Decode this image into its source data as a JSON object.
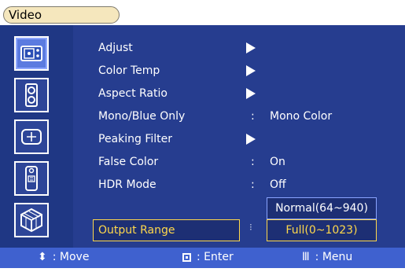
{
  "header": {
    "title": "Video"
  },
  "sidebar": {
    "items": [
      {
        "icon": "video-settings-icon"
      },
      {
        "icon": "audio-speaker-icon"
      },
      {
        "icon": "target-crosshair-icon"
      },
      {
        "icon": "remote-control-icon"
      },
      {
        "icon": "cube-icon"
      }
    ]
  },
  "menu": {
    "items": [
      {
        "label": "Adjust"
      },
      {
        "label": "Color Temp"
      },
      {
        "label": "Aspect Ratio"
      },
      {
        "label": "Mono/Blue Only",
        "value": "Mono Color"
      },
      {
        "label": "Peaking Filter"
      },
      {
        "label": "False Color",
        "value": "On"
      },
      {
        "label": "HDR Mode",
        "value": "Off"
      },
      {
        "label": "Output Range"
      }
    ]
  },
  "dropdown": {
    "options": [
      {
        "label": "Normal(64~940)"
      },
      {
        "label": "Full(0~1023)"
      }
    ]
  },
  "footer": {
    "move": ": Move",
    "enter": ": Enter",
    "menu": ": Menu"
  },
  "colors": {
    "background": "#263d8f",
    "statusbar": "#3f61cf",
    "selection": "#ffd84b"
  }
}
